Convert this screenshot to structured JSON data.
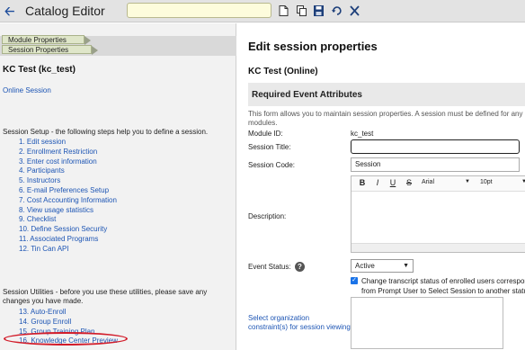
{
  "topbar": {
    "title": "Catalog Editor",
    "title_input_value": "",
    "icons": [
      "back-arrow-icon",
      "new-document-icon",
      "copy-icon",
      "save-icon",
      "undo-icon",
      "excel-icon"
    ]
  },
  "left": {
    "tabs": [
      "Module Properties",
      "Session Properties"
    ],
    "course_title": "KC Test (kc_test)",
    "online_link": "Online Session",
    "setup_text": "Session Setup - the following steps help you to define a session.",
    "steps": [
      "1. Edit session",
      "2. Enrollment Restriction",
      "3. Enter cost information",
      "4. Participants",
      "5. Instructors",
      "6. E-mail Preferences Setup",
      "7. Cost Accounting Information",
      "8. View usage statistics",
      "9. Checklist",
      "10. Define Session Security",
      "11. Associated Programs",
      "12. Tin Can API"
    ],
    "utilities_text": "Session Utilities - before you use these utilities, please save any changes you have made.",
    "utilities": [
      "13. Auto-Enroll",
      "14. Group Enroll",
      "15. Group Training Plan",
      "16. Knowledge Center Preview"
    ]
  },
  "right": {
    "edit_title": "Edit session properties",
    "kc_title": "KC Test (Online)",
    "section_title": "Required Event Attributes",
    "help_line1": "This form allows you to maintain session properties. A session must be defined for any o",
    "help_line2": "modules.",
    "module_id_label": "Module ID:",
    "module_id_value": "kc_test",
    "session_title_label": "Session Title:",
    "session_title_value": "",
    "session_code_label": "Session Code:",
    "session_code_value": "Session",
    "description_label": "Description:",
    "editor": {
      "bold": "B",
      "italic": "I",
      "underline": "U",
      "strike": "S",
      "font": "Arial",
      "size": "10pt"
    },
    "event_status_label": "Event Status:",
    "event_status_value": "Active",
    "transcript_line1": "Change transcript status of enrolled users correspon",
    "transcript_line2": "from Prompt User to Select Session to another status.",
    "org_link_line1": "Select organization",
    "org_link_line2": "constraint(s) for session viewing"
  }
}
